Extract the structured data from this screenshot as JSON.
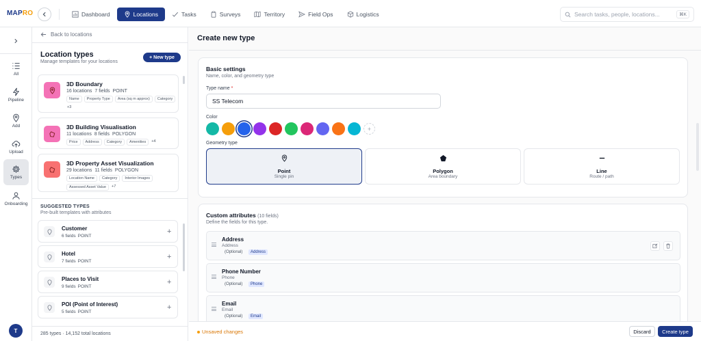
{
  "brand": {
    "part1": "MAP",
    "part2": "RO"
  },
  "colors": {
    "accent": "#1e3a8a",
    "warning": "#d97706"
  },
  "nav": {
    "items": [
      {
        "label": "Dashboard",
        "icon": "chart-bar-icon"
      },
      {
        "label": "Locations",
        "icon": "map-pin-icon",
        "active": true
      },
      {
        "label": "Tasks",
        "icon": "check-icon"
      },
      {
        "label": "Surveys",
        "icon": "clipboard-icon"
      },
      {
        "label": "Territory",
        "icon": "map-icon"
      },
      {
        "label": "Field Ops",
        "icon": "send-icon"
      },
      {
        "label": "Logistics",
        "icon": "box-icon"
      }
    ]
  },
  "search": {
    "placeholder": "Search tasks, people, locations...",
    "shortcut": "⌘K"
  },
  "rail": {
    "items": [
      {
        "label": "All",
        "icon": "list-icon"
      },
      {
        "label": "Pipeline",
        "icon": "bolt-icon"
      },
      {
        "label": "Add",
        "icon": "map-pin-icon"
      },
      {
        "label": "Upload",
        "icon": "cloud-upload-icon"
      },
      {
        "label": "Types",
        "icon": "gear-icon",
        "active": true
      },
      {
        "label": "Onboarding",
        "icon": "users-icon"
      }
    ],
    "avatar": "T"
  },
  "left": {
    "back": "Back to locations",
    "title": "Location types",
    "subtitle": "Manage templates for your locations",
    "new_button": "+ New type",
    "types": [
      {
        "name": "3D Boundary",
        "locations": "16 locations",
        "fields": "7 fields",
        "geometry": "POINT",
        "chips": [
          "Name",
          "Property Type",
          "Area (sq m approx)",
          "Category"
        ],
        "more": "+3"
      },
      {
        "name": "3D Building Visualisation",
        "locations": "11 locations",
        "fields": "8 fields",
        "geometry": "POLYGON",
        "chips": [
          "Price",
          "Address",
          "Category",
          "Amenities"
        ],
        "more": "+4"
      },
      {
        "name": "3D Property Asset Visualization",
        "locations": "29 locations",
        "fields": "11 fields",
        "geometry": "POLYGON",
        "chips": [
          "Location Name",
          "Category",
          "Interior Images",
          "Assessed Asset Value"
        ],
        "more": "+7"
      }
    ],
    "suggested_title": "SUGGESTED TYPES",
    "suggested_sub": "Pre-built templates with attributes",
    "suggested": [
      {
        "name": "Customer",
        "fields": "6 fields",
        "geometry": "POINT"
      },
      {
        "name": "Hotel",
        "fields": "7 fields",
        "geometry": "POINT"
      },
      {
        "name": "Places to Visit",
        "fields": "9 fields",
        "geometry": "POINT"
      },
      {
        "name": "POI (Point of Interest)",
        "fields": "5 fields",
        "geometry": "POINT"
      }
    ],
    "footer": "285 types · 14,152 total locations"
  },
  "main": {
    "title": "Create new type",
    "basic": {
      "title": "Basic settings",
      "subtitle": "Name, color, and geometry type",
      "name_label": "Type name",
      "name_value": "SS Telecom",
      "color_label": "Color",
      "colors": [
        "#14b8a6",
        "#f59e0b",
        "#2563eb",
        "#9333ea",
        "#dc2626",
        "#22c55e",
        "#db2777",
        "#6366f1",
        "#f97316",
        "#06b6d4"
      ],
      "selected_color": "#2563eb",
      "geometry_label": "Geometry type",
      "geometry": [
        {
          "name": "Point",
          "sub": "Single pin",
          "icon": "map-pin-icon",
          "active": true
        },
        {
          "name": "Polygon",
          "sub": "Area boundary",
          "icon": "pentagon-icon"
        },
        {
          "name": "Line",
          "sub": "Route / path",
          "icon": "line-icon"
        }
      ]
    },
    "custom": {
      "title": "Custom attributes",
      "count": "(10 fields)",
      "subtitle": "Define the fields for this type.",
      "attributes": [
        {
          "name": "Address",
          "sub": "Address",
          "optional": "(Optional)",
          "type": "Address"
        },
        {
          "name": "Phone Number",
          "sub": "Phone",
          "optional": "(Optional)",
          "type": "Phone"
        },
        {
          "name": "Email",
          "sub": "Email",
          "optional": "(Optional)",
          "type": "Email"
        }
      ]
    }
  },
  "bottom": {
    "unsaved": "Unsaved changes",
    "discard": "Discard",
    "create": "Create type"
  }
}
